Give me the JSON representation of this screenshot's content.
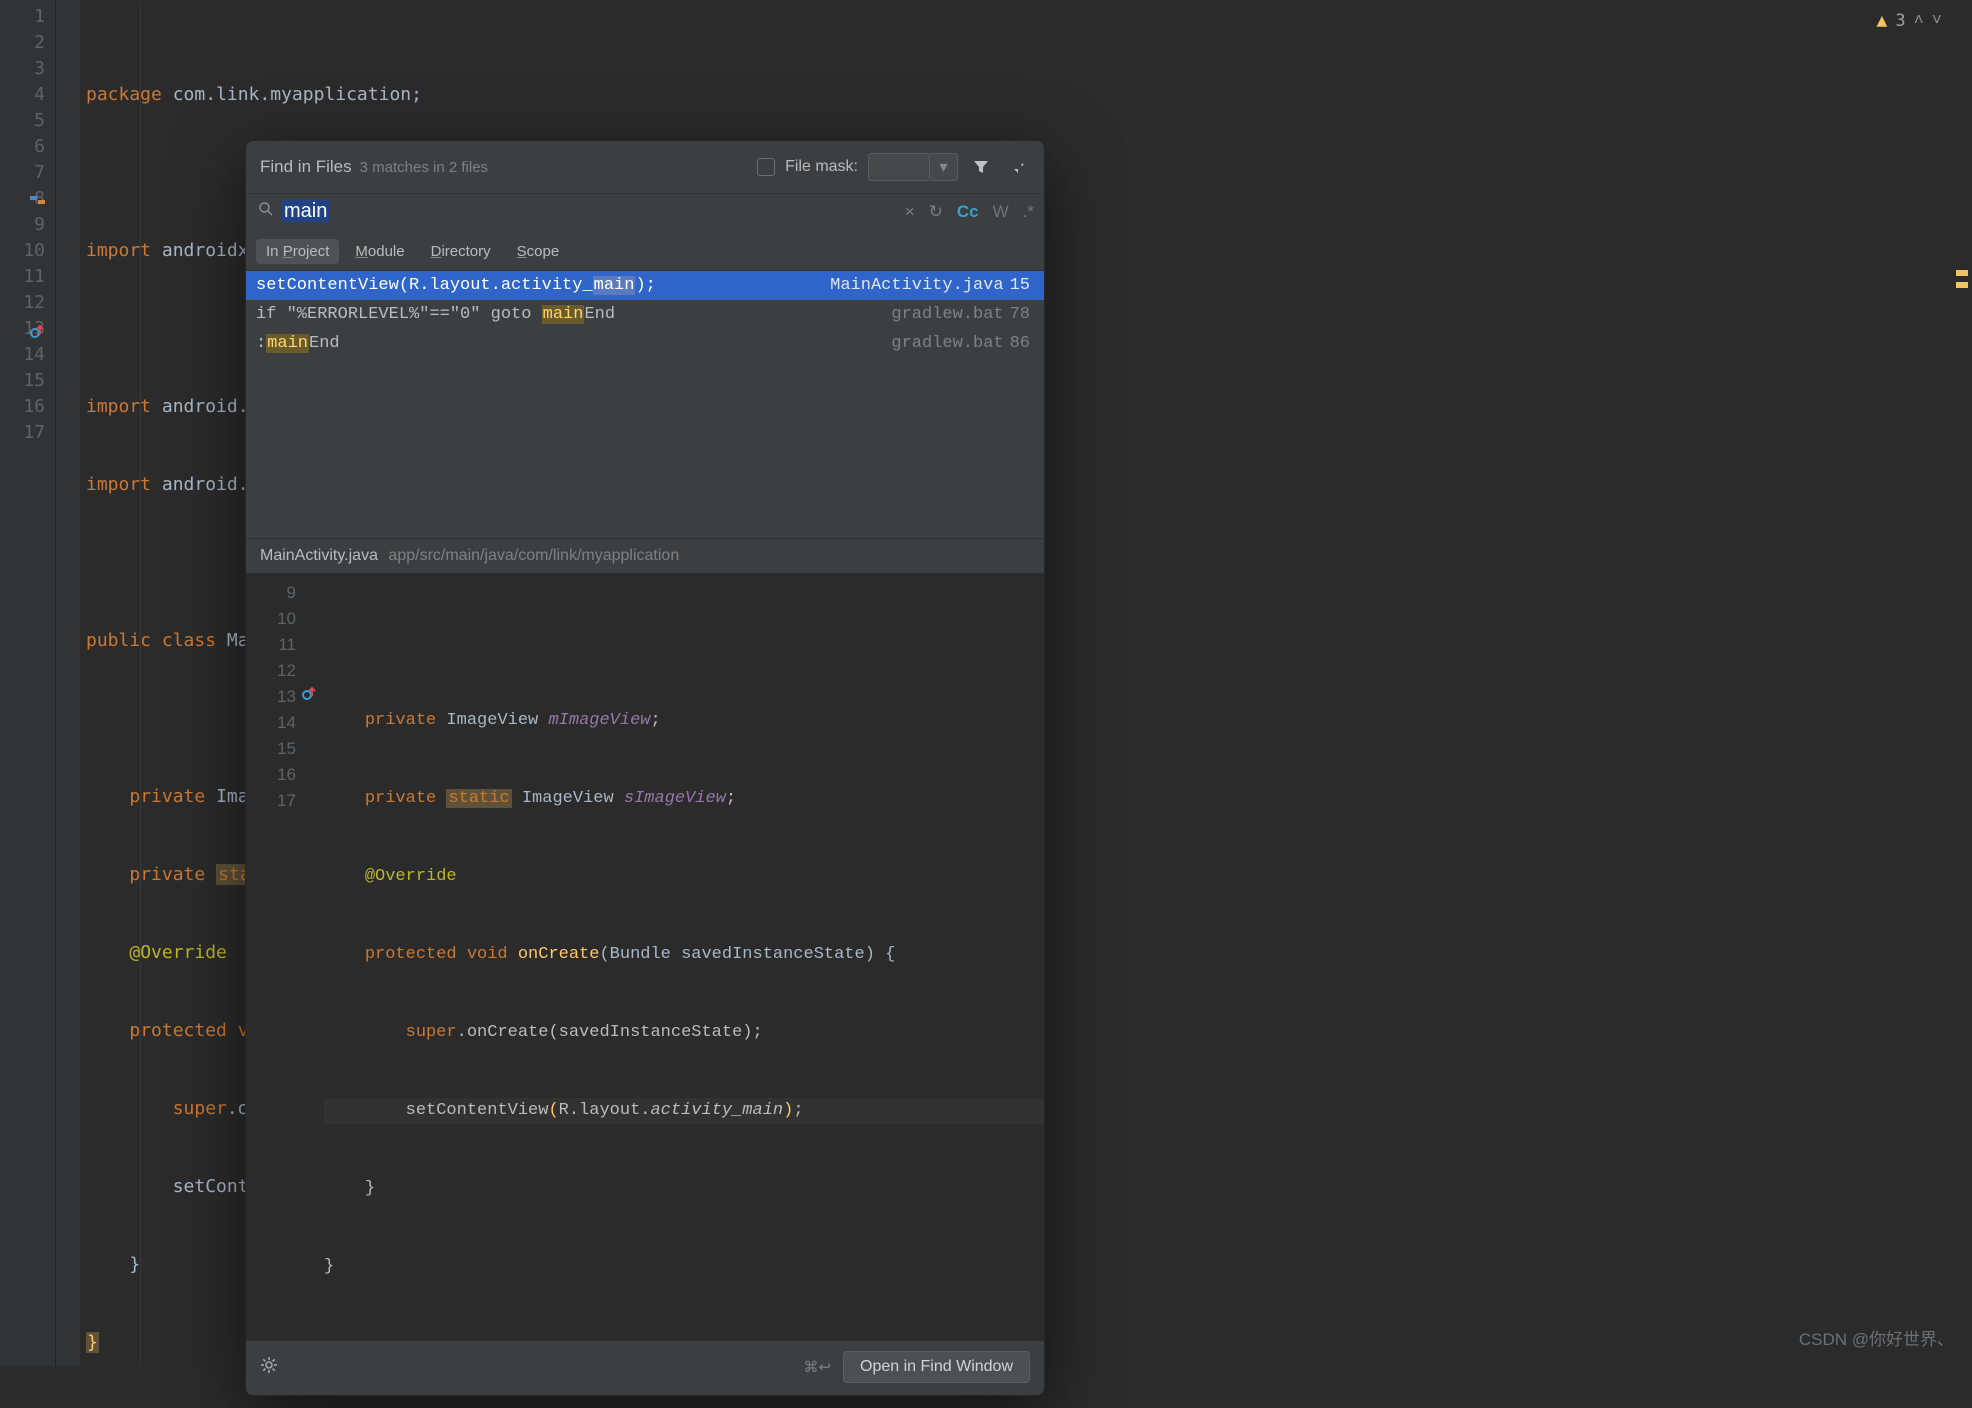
{
  "warnings": {
    "count": "3"
  },
  "editor_lines": {
    "l1": "package com.link.myapplication;",
    "l2": "",
    "l3": "import androidx.appcompat.app.AppCompatActivity;",
    "l4": "",
    "l5": "import android.os.Bundle;",
    "l6": "import android.widget.ImageView;",
    "l7": "",
    "l8": "public class MainA",
    "l9": "",
    "l10": "    private ImageV",
    "l11": "    private static",
    "l12": "    @Override",
    "l13": "    protected void",
    "l14": "        super.onCr",
    "l15": "        setContent",
    "l16": "    }",
    "l17": "}"
  },
  "line_numbers": [
    "1",
    "2",
    "3",
    "4",
    "5",
    "6",
    "7",
    "8",
    "9",
    "10",
    "11",
    "12",
    "13",
    "14",
    "15",
    "16",
    "17"
  ],
  "dialog": {
    "title": "Find in Files",
    "sub": "3 matches in 2 files",
    "file_mask_label": "File mask:",
    "search_value": "main",
    "tabs": {
      "in_project": "In Project",
      "module": "Module",
      "directory": "Directory",
      "scope": "Scope"
    },
    "results": [
      {
        "text_pre": "setContentView(R.layout.activity_",
        "hit": "main",
        "text_post": ");",
        "file": "MainActivity.java",
        "line": "15",
        "sel": true
      },
      {
        "text_pre": "if \"%ERRORLEVEL%\"==\"0\" goto ",
        "hit": "main",
        "text_post": "End",
        "file": "gradlew.bat",
        "line": "78",
        "sel": false
      },
      {
        "text_pre": ":",
        "hit": "main",
        "text_post": "End",
        "file": "gradlew.bat",
        "line": "86",
        "sel": false
      }
    ],
    "preview": {
      "file": "MainActivity.java",
      "path": "app/src/main/java/com/link/myapplication",
      "lines": [
        {
          "n": "9",
          "code_a": "",
          "code_b": ""
        },
        {
          "n": "10",
          "code_a": "    private ",
          "type": "ImageView",
          "fld": " mImageView",
          "tail": ";"
        },
        {
          "n": "11",
          "code_a": "    private ",
          "stat": "static",
          "sp": " ",
          "type": "ImageView",
          "fld": " sImageView",
          "tail": ";"
        },
        {
          "n": "12",
          "code_a": "    ",
          "ann": "@Override"
        },
        {
          "n": "13",
          "code_a": "    protected void ",
          "mth": "onCreate",
          "args": "(Bundle savedInstanceState) {"
        },
        {
          "n": "14",
          "code_a": "        super.onCreate(savedInstanceState);"
        },
        {
          "n": "15",
          "code_a": "        setContentView(R.layout.",
          "ital": "activity_main",
          "tail": ");",
          "hl": true
        },
        {
          "n": "16",
          "code_a": "    }"
        },
        {
          "n": "17",
          "code_a": "}"
        }
      ]
    },
    "open_button": "Open in Find Window",
    "shortcut_hint": "⌘↩"
  },
  "watermark": "CSDN @你好世界、"
}
